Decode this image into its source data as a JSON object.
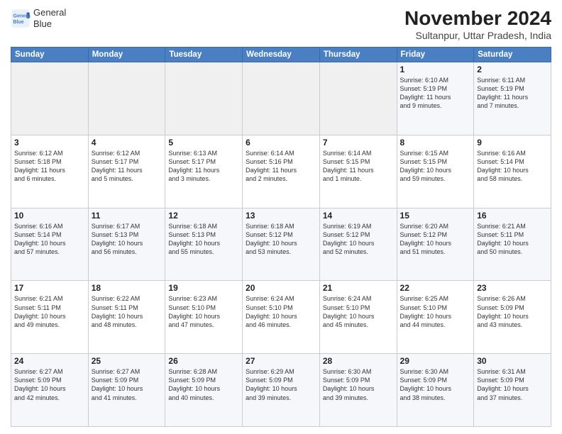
{
  "logo": {
    "line1": "General",
    "line2": "Blue"
  },
  "title": "November 2024",
  "location": "Sultanpur, Uttar Pradesh, India",
  "weekdays": [
    "Sunday",
    "Monday",
    "Tuesday",
    "Wednesday",
    "Thursday",
    "Friday",
    "Saturday"
  ],
  "weeks": [
    [
      {
        "day": "",
        "info": ""
      },
      {
        "day": "",
        "info": ""
      },
      {
        "day": "",
        "info": ""
      },
      {
        "day": "",
        "info": ""
      },
      {
        "day": "",
        "info": ""
      },
      {
        "day": "1",
        "info": "Sunrise: 6:10 AM\nSunset: 5:19 PM\nDaylight: 11 hours\nand 9 minutes."
      },
      {
        "day": "2",
        "info": "Sunrise: 6:11 AM\nSunset: 5:19 PM\nDaylight: 11 hours\nand 7 minutes."
      }
    ],
    [
      {
        "day": "3",
        "info": "Sunrise: 6:12 AM\nSunset: 5:18 PM\nDaylight: 11 hours\nand 6 minutes."
      },
      {
        "day": "4",
        "info": "Sunrise: 6:12 AM\nSunset: 5:17 PM\nDaylight: 11 hours\nand 5 minutes."
      },
      {
        "day": "5",
        "info": "Sunrise: 6:13 AM\nSunset: 5:17 PM\nDaylight: 11 hours\nand 3 minutes."
      },
      {
        "day": "6",
        "info": "Sunrise: 6:14 AM\nSunset: 5:16 PM\nDaylight: 11 hours\nand 2 minutes."
      },
      {
        "day": "7",
        "info": "Sunrise: 6:14 AM\nSunset: 5:15 PM\nDaylight: 11 hours\nand 1 minute."
      },
      {
        "day": "8",
        "info": "Sunrise: 6:15 AM\nSunset: 5:15 PM\nDaylight: 10 hours\nand 59 minutes."
      },
      {
        "day": "9",
        "info": "Sunrise: 6:16 AM\nSunset: 5:14 PM\nDaylight: 10 hours\nand 58 minutes."
      }
    ],
    [
      {
        "day": "10",
        "info": "Sunrise: 6:16 AM\nSunset: 5:14 PM\nDaylight: 10 hours\nand 57 minutes."
      },
      {
        "day": "11",
        "info": "Sunrise: 6:17 AM\nSunset: 5:13 PM\nDaylight: 10 hours\nand 56 minutes."
      },
      {
        "day": "12",
        "info": "Sunrise: 6:18 AM\nSunset: 5:13 PM\nDaylight: 10 hours\nand 55 minutes."
      },
      {
        "day": "13",
        "info": "Sunrise: 6:18 AM\nSunset: 5:12 PM\nDaylight: 10 hours\nand 53 minutes."
      },
      {
        "day": "14",
        "info": "Sunrise: 6:19 AM\nSunset: 5:12 PM\nDaylight: 10 hours\nand 52 minutes."
      },
      {
        "day": "15",
        "info": "Sunrise: 6:20 AM\nSunset: 5:12 PM\nDaylight: 10 hours\nand 51 minutes."
      },
      {
        "day": "16",
        "info": "Sunrise: 6:21 AM\nSunset: 5:11 PM\nDaylight: 10 hours\nand 50 minutes."
      }
    ],
    [
      {
        "day": "17",
        "info": "Sunrise: 6:21 AM\nSunset: 5:11 PM\nDaylight: 10 hours\nand 49 minutes."
      },
      {
        "day": "18",
        "info": "Sunrise: 6:22 AM\nSunset: 5:11 PM\nDaylight: 10 hours\nand 48 minutes."
      },
      {
        "day": "19",
        "info": "Sunrise: 6:23 AM\nSunset: 5:10 PM\nDaylight: 10 hours\nand 47 minutes."
      },
      {
        "day": "20",
        "info": "Sunrise: 6:24 AM\nSunset: 5:10 PM\nDaylight: 10 hours\nand 46 minutes."
      },
      {
        "day": "21",
        "info": "Sunrise: 6:24 AM\nSunset: 5:10 PM\nDaylight: 10 hours\nand 45 minutes."
      },
      {
        "day": "22",
        "info": "Sunrise: 6:25 AM\nSunset: 5:10 PM\nDaylight: 10 hours\nand 44 minutes."
      },
      {
        "day": "23",
        "info": "Sunrise: 6:26 AM\nSunset: 5:09 PM\nDaylight: 10 hours\nand 43 minutes."
      }
    ],
    [
      {
        "day": "24",
        "info": "Sunrise: 6:27 AM\nSunset: 5:09 PM\nDaylight: 10 hours\nand 42 minutes."
      },
      {
        "day": "25",
        "info": "Sunrise: 6:27 AM\nSunset: 5:09 PM\nDaylight: 10 hours\nand 41 minutes."
      },
      {
        "day": "26",
        "info": "Sunrise: 6:28 AM\nSunset: 5:09 PM\nDaylight: 10 hours\nand 40 minutes."
      },
      {
        "day": "27",
        "info": "Sunrise: 6:29 AM\nSunset: 5:09 PM\nDaylight: 10 hours\nand 39 minutes."
      },
      {
        "day": "28",
        "info": "Sunrise: 6:30 AM\nSunset: 5:09 PM\nDaylight: 10 hours\nand 39 minutes."
      },
      {
        "day": "29",
        "info": "Sunrise: 6:30 AM\nSunset: 5:09 PM\nDaylight: 10 hours\nand 38 minutes."
      },
      {
        "day": "30",
        "info": "Sunrise: 6:31 AM\nSunset: 5:09 PM\nDaylight: 10 hours\nand 37 minutes."
      }
    ]
  ]
}
